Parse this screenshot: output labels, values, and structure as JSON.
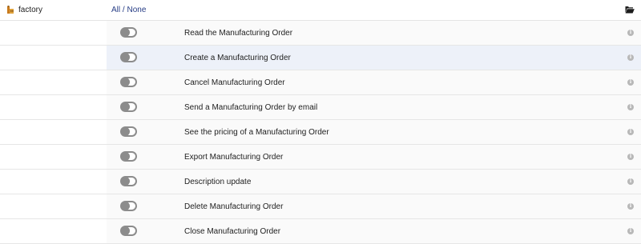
{
  "module": {
    "label": "factory",
    "icon": "factory-icon"
  },
  "all_label": "All",
  "separator": " / ",
  "none_label": "None",
  "folder_icon": "folder-open-icon",
  "info_icon_glyph": "i",
  "colors": {
    "link": "#263c85",
    "toggle_off": "#8c8c8c",
    "row_highlight": "#edf1f9"
  },
  "permissions": [
    {
      "label": "Read the Manufacturing Order",
      "enabled": false
    },
    {
      "label": "Create a Manufacturing Order",
      "enabled": false
    },
    {
      "label": "Cancel Manufacturing Order",
      "enabled": false
    },
    {
      "label": "Send a Manufacturing Order by email",
      "enabled": false
    },
    {
      "label": "See the pricing of a Manufacturing Order",
      "enabled": false
    },
    {
      "label": "Export Manufacturing Order",
      "enabled": false
    },
    {
      "label": "Description update",
      "enabled": false
    },
    {
      "label": "Delete Manufacturing Order",
      "enabled": false
    },
    {
      "label": "Close Manufacturing Order",
      "enabled": false
    }
  ]
}
